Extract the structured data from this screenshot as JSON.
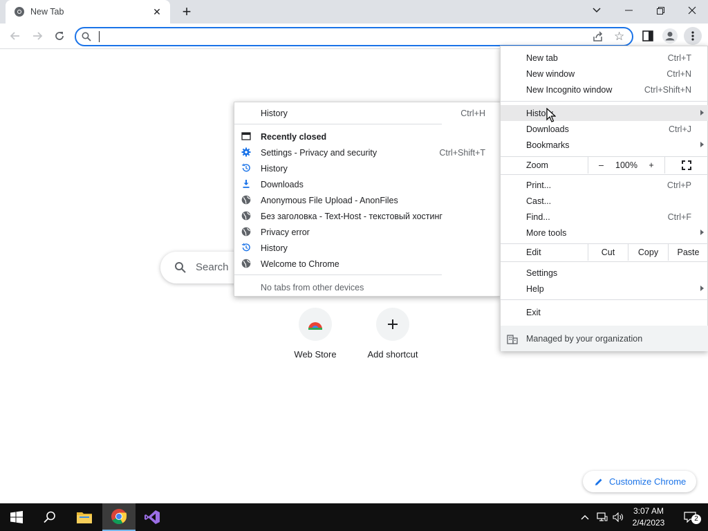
{
  "tab": {
    "title": "New Tab",
    "close_icon": "close-icon"
  },
  "omnibox": {
    "value": "",
    "placeholder": ""
  },
  "ntp": {
    "search_placeholder": "Search",
    "tiles": [
      {
        "label": "Web Store"
      },
      {
        "label": "Add shortcut"
      }
    ],
    "customize_label": "Customize Chrome"
  },
  "main_menu": {
    "new_tab": {
      "label": "New tab",
      "shortcut": "Ctrl+T"
    },
    "new_window": {
      "label": "New window",
      "shortcut": "Ctrl+N"
    },
    "new_incognito": {
      "label": "New Incognito window",
      "shortcut": "Ctrl+Shift+N"
    },
    "history": {
      "label": "History"
    },
    "downloads": {
      "label": "Downloads",
      "shortcut": "Ctrl+J"
    },
    "bookmarks": {
      "label": "Bookmarks"
    },
    "zoom": {
      "label": "Zoom",
      "minus": "–",
      "value": "100%",
      "plus": "+"
    },
    "print": {
      "label": "Print...",
      "shortcut": "Ctrl+P"
    },
    "cast": {
      "label": "Cast..."
    },
    "find": {
      "label": "Find...",
      "shortcut": "Ctrl+F"
    },
    "more_tools": {
      "label": "More tools"
    },
    "edit": {
      "label": "Edit",
      "cut": "Cut",
      "copy": "Copy",
      "paste": "Paste"
    },
    "settings": {
      "label": "Settings"
    },
    "help": {
      "label": "Help"
    },
    "exit": {
      "label": "Exit"
    },
    "managed": {
      "label": "Managed by your organization"
    }
  },
  "history_menu": {
    "history": {
      "label": "History",
      "shortcut": "Ctrl+H"
    },
    "recently_closed": "Recently closed",
    "items": [
      {
        "label": "Settings - Privacy and security",
        "shortcut": "Ctrl+Shift+T",
        "icon": "gear-icon"
      },
      {
        "label": "History",
        "shortcut": "",
        "icon": "history-icon"
      },
      {
        "label": "Downloads",
        "shortcut": "",
        "icon": "download-icon"
      },
      {
        "label": "Anonymous File Upload - AnonFiles",
        "shortcut": "",
        "icon": "globe-icon"
      },
      {
        "label": "Без заголовка - Text-Host - текстовый хостинг",
        "shortcut": "",
        "icon": "globe-icon"
      },
      {
        "label": "Privacy error",
        "shortcut": "",
        "icon": "globe-icon"
      },
      {
        "label": "History",
        "shortcut": "",
        "icon": "history-icon"
      },
      {
        "label": "Welcome to Chrome",
        "shortcut": "",
        "icon": "globe-icon"
      }
    ],
    "no_tabs": "No tabs from other devices"
  },
  "taskbar": {
    "time": "3:07 AM",
    "date": "2/4/2023",
    "notification_count": "2"
  },
  "colors": {
    "accent": "#1a73e8",
    "taskbar": "#101010",
    "menu_highlight": "#e8e8e9"
  }
}
